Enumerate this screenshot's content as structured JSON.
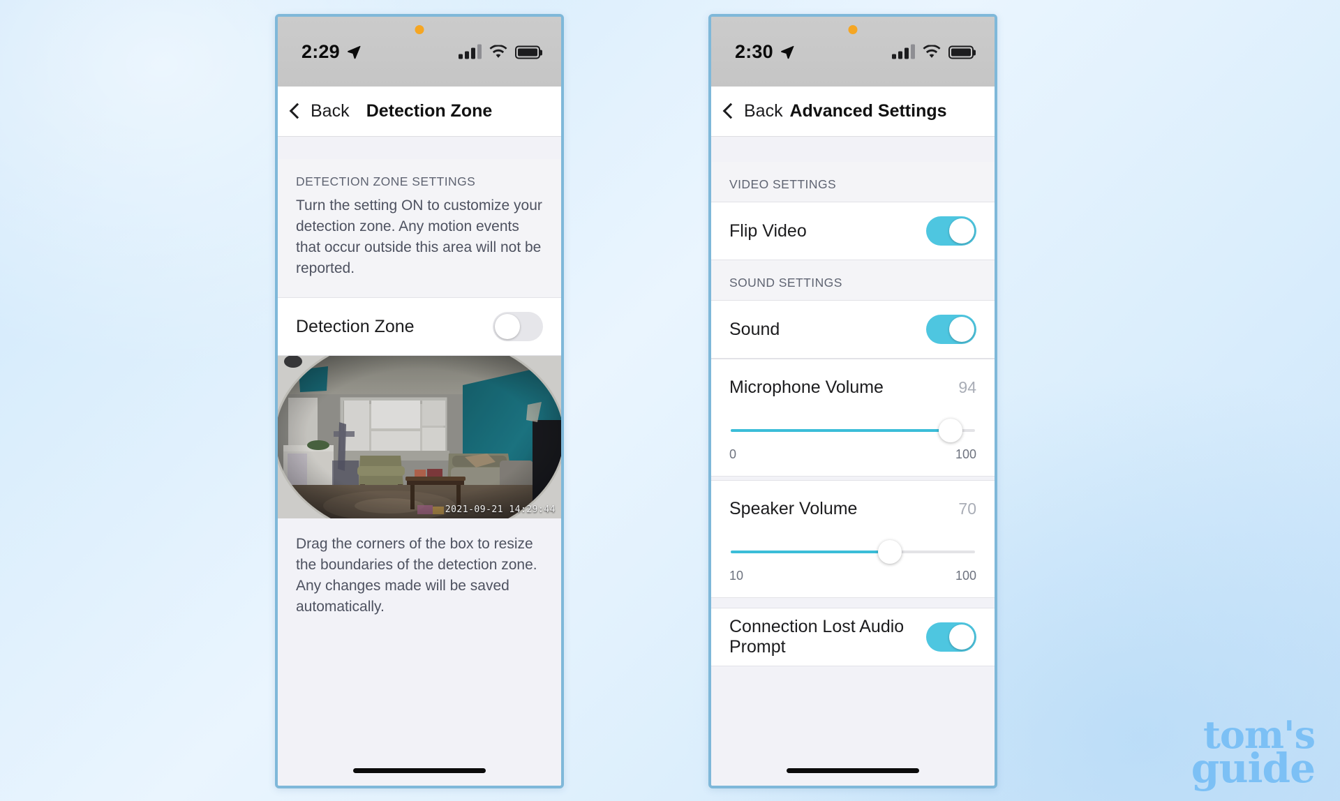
{
  "background": {
    "accent_blue": "#7cc0f5",
    "page_gradient_from": "#cfe7fb",
    "page_gradient_to": "#c9e3fa"
  },
  "watermark": {
    "line1": "tom's",
    "line2": "guide",
    "color": "#7cc0f5"
  },
  "phones": [
    {
      "id": "detection-zone",
      "status_bar": {
        "time": "2:29",
        "location_icon": "location-arrow-icon",
        "cellular_icon": "cellular-signal-icon",
        "wifi_icon": "wifi-icon",
        "battery_icon": "battery-icon",
        "recording_dot": "orange-privacy-dot"
      },
      "nav": {
        "back_label": "Back",
        "back_icon": "chevron-left-icon",
        "title": "Detection Zone"
      },
      "section": {
        "header": "DETECTION ZONE SETTINGS",
        "description": "Turn the setting ON to customize your detection zone. Any motion events that occur outside this area will not be reported."
      },
      "toggle_row": {
        "label": "Detection Zone",
        "state": "off",
        "state_label": "OFF"
      },
      "camera": {
        "timestamp": "2021-09-21 14:29:44",
        "alt": "Live fisheye camera view of a living room with teal accent wall, windows, sofas and coffee table"
      },
      "caption": "Drag the corners of the box to resize the boundaries of the detection zone. Any changes made will be saved automatically."
    },
    {
      "id": "advanced-settings",
      "status_bar": {
        "time": "2:30",
        "location_icon": "location-arrow-icon",
        "cellular_icon": "cellular-signal-icon",
        "wifi_icon": "wifi-icon",
        "battery_icon": "battery-icon",
        "recording_dot": "orange-privacy-dot"
      },
      "nav": {
        "back_label": "Back",
        "back_icon": "chevron-left-icon",
        "title": "Advanced Settings"
      },
      "video_section": {
        "header": "VIDEO SETTINGS",
        "rows": [
          {
            "label": "Flip Video",
            "state": "on",
            "state_label": "ON"
          }
        ]
      },
      "sound_section": {
        "header": "SOUND SETTINGS",
        "toggle_rows": [
          {
            "label": "Sound",
            "state": "on",
            "state_label": "ON"
          }
        ],
        "sliders": [
          {
            "label": "Microphone Volume",
            "value": 94,
            "min": 0,
            "max": 100,
            "min_label": "0",
            "max_label": "100",
            "value_label": "94",
            "fill_color": "#3bbdd8"
          },
          {
            "label": "Speaker Volume",
            "value": 70,
            "min": 10,
            "max": 100,
            "min_label": "10",
            "max_label": "100",
            "value_label": "70",
            "fill_color": "#3bbdd8"
          }
        ],
        "bottom_rows": [
          {
            "label": "Connection Lost Audio Prompt",
            "state": "on",
            "state_label": "ON"
          }
        ]
      }
    }
  ]
}
